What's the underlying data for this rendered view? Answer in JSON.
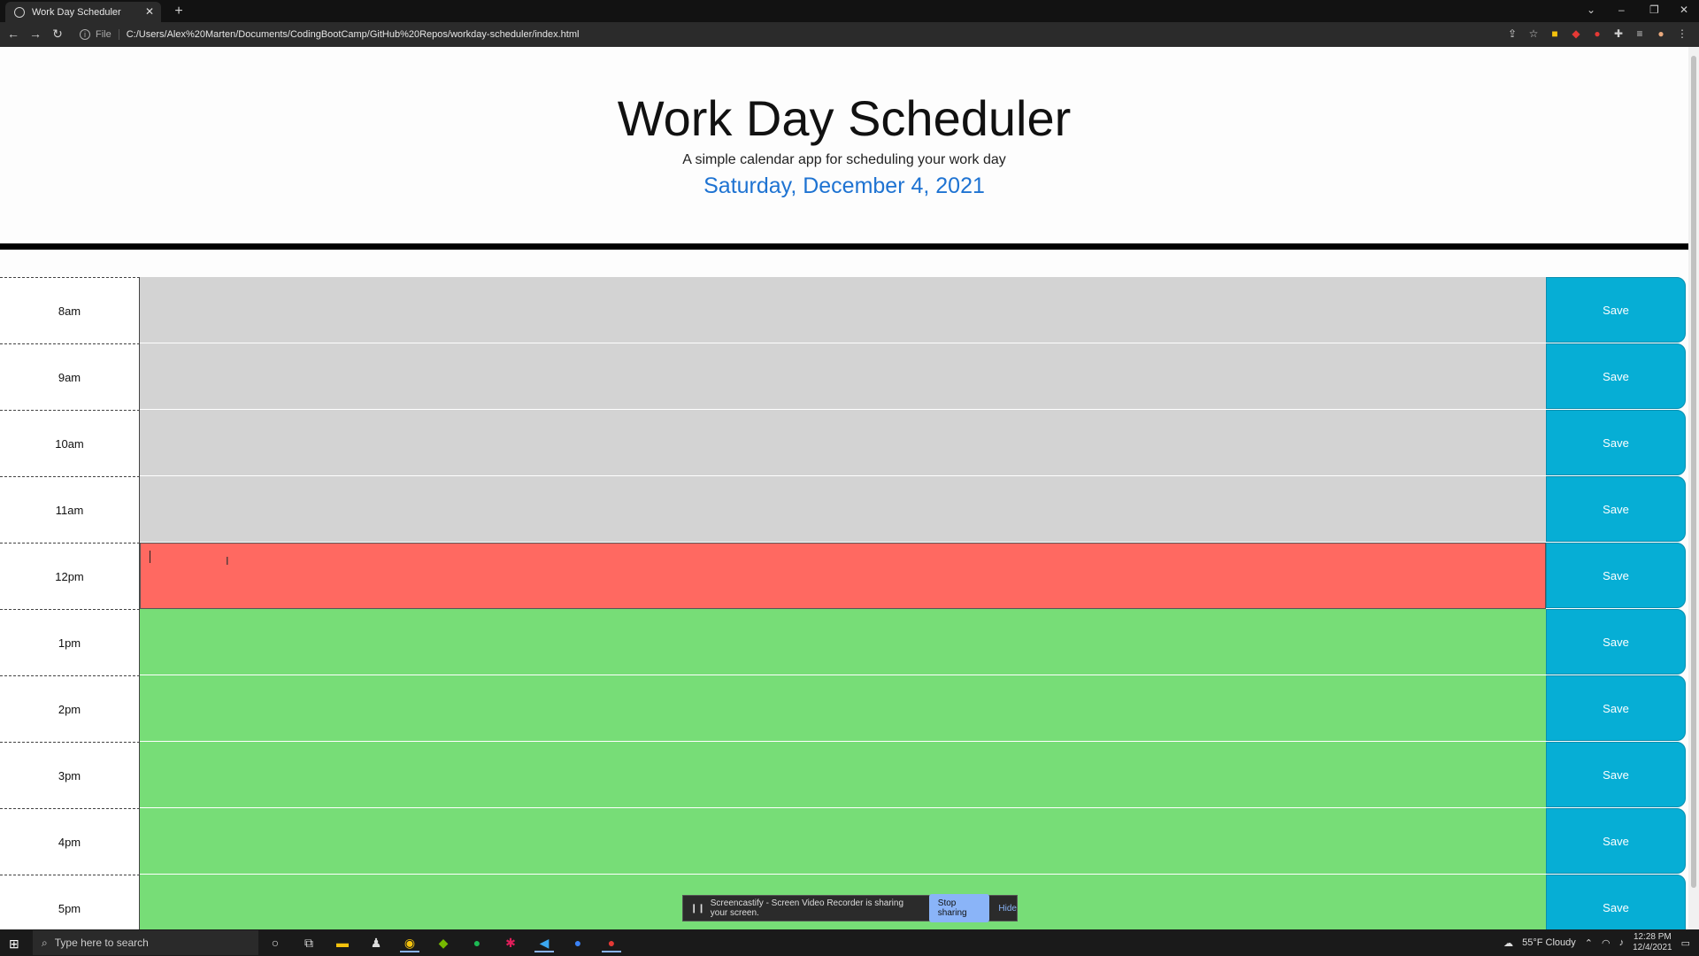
{
  "browser": {
    "tab_title": "Work Day Scheduler",
    "tab_close": "✕",
    "new_tab": "+",
    "url_label": "File",
    "url": "C:/Users/Alex%20Marten/Documents/CodingBootCamp/GitHub%20Repos/workday-scheduler/index.html",
    "window_controls": [
      "⌄",
      "–",
      "❐",
      "✕"
    ],
    "nav": [
      "←",
      "→",
      "↻"
    ]
  },
  "header": {
    "title": "Work Day Scheduler",
    "lead": "A simple calendar app for scheduling your work day",
    "date": "Saturday, December 4, 2021"
  },
  "colors": {
    "past": "#d3d3d3",
    "present": "#ff6961",
    "future": "#77dd77",
    "save": "#06aed5",
    "date": "#1e73d2"
  },
  "schedule": [
    {
      "hour": "8am",
      "state": "past",
      "text": "",
      "save": "Save"
    },
    {
      "hour": "9am",
      "state": "past",
      "text": "",
      "save": "Save"
    },
    {
      "hour": "10am",
      "state": "past",
      "text": "",
      "save": "Save"
    },
    {
      "hour": "11am",
      "state": "past",
      "text": "",
      "save": "Save"
    },
    {
      "hour": "12pm",
      "state": "present",
      "text": "",
      "save": "Save"
    },
    {
      "hour": "1pm",
      "state": "future",
      "text": "",
      "save": "Save"
    },
    {
      "hour": "2pm",
      "state": "future",
      "text": "",
      "save": "Save"
    },
    {
      "hour": "3pm",
      "state": "future",
      "text": "",
      "save": "Save"
    },
    {
      "hour": "4pm",
      "state": "future",
      "text": "",
      "save": "Save"
    },
    {
      "hour": "5pm",
      "state": "future",
      "text": "",
      "save": "Save"
    }
  ],
  "share_bar": {
    "message": "Screencastify - Screen Video Recorder is sharing your screen.",
    "stop": "Stop sharing",
    "hide": "Hide"
  },
  "taskbar": {
    "search_placeholder": "Type here to search",
    "weather": "55°F  Cloudy",
    "time": "12:28 PM",
    "date": "12/4/2021"
  }
}
